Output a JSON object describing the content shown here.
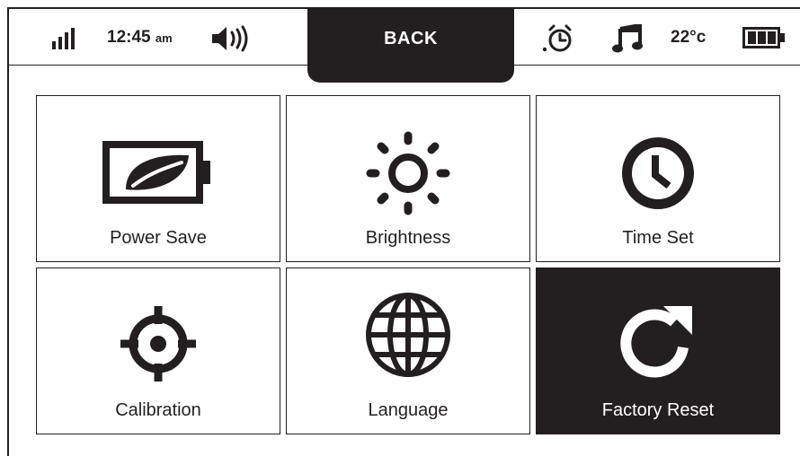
{
  "status_bar": {
    "signal_icon": "signal-bars-icon",
    "time": "12:45",
    "ampm": "am",
    "volume_icon": "speaker-volume-icon",
    "alarm_icon": "alarm-clock-icon",
    "music_icon": "music-note-icon",
    "temperature": "22°c",
    "battery_icon": "battery-full-icon"
  },
  "back_button": {
    "label": "BACK"
  },
  "menu": {
    "tiles": [
      {
        "label": "Power Save",
        "icon": "battery-leaf-icon"
      },
      {
        "label": "Brightness",
        "icon": "sun-icon"
      },
      {
        "label": "Time Set",
        "icon": "clock-icon"
      },
      {
        "label": "Calibration",
        "icon": "crosshair-icon"
      },
      {
        "label": "Language",
        "icon": "globe-icon"
      },
      {
        "label": "Factory Reset",
        "icon": "reset-arrow-icon",
        "selected": true
      }
    ]
  },
  "colors": {
    "foreground": "#231f20",
    "background": "#ffffff",
    "selected_bg": "#231f20"
  }
}
